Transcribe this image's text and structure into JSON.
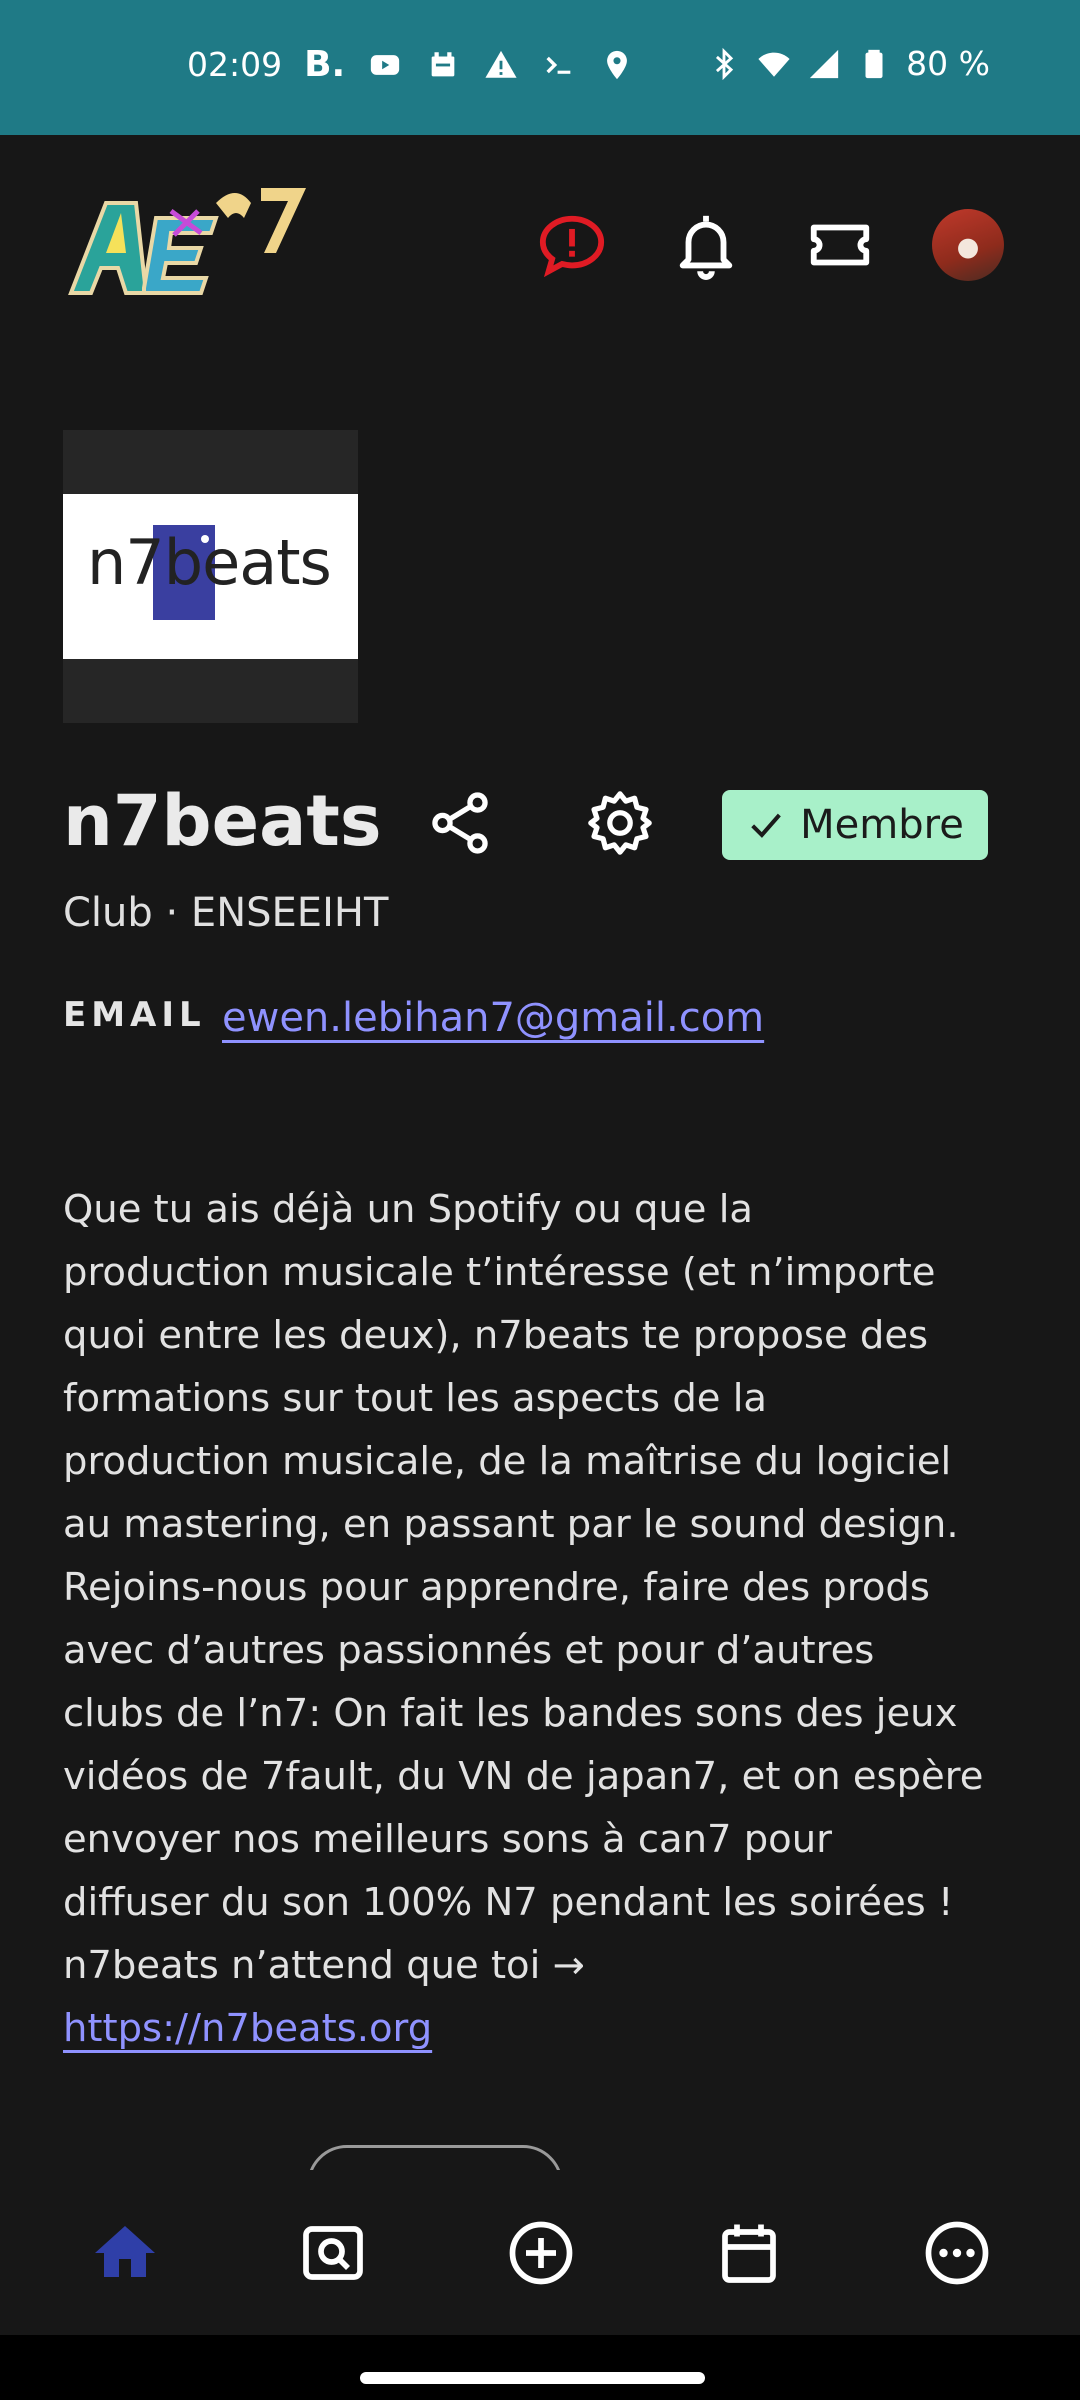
{
  "status_bar": {
    "time": "02:09",
    "b_label": "B.",
    "battery": "80 %",
    "icons": [
      "youtube-icon",
      "calendar-icon",
      "warning-icon",
      "terminal-icon",
      "location-icon",
      "bluetooth-icon",
      "wifi-icon",
      "signal-icon",
      "battery-icon"
    ]
  },
  "app_bar": {
    "logo_name": "AE n7 logo",
    "icons": [
      "report-bug-icon",
      "notifications-icon",
      "ticket-icon",
      "avatar"
    ]
  },
  "club": {
    "logo_text": "n7beats",
    "name": "n7beats",
    "subtitle": "Club · ENSEEIHT",
    "member_label": "Membre",
    "email_label": "EMAIL",
    "email": "ewen.lebihan7@gmail.com",
    "description": [
      "Que tu ais déjà un Spotify ou que la",
      "production musicale t’intéresse (et n’importe",
      "quoi entre les deux), n7beats te propose des",
      "formations sur tout les aspects de la",
      "production musicale, de la maîtrise du logiciel",
      "au mastering, en passant par le sound design.",
      "Rejoins-nous pour apprendre, faire des prods",
      "avec d’autres passionnés et pour d’autres",
      "clubs de l’n7: On fait les bandes sons des jeux",
      "vidéos de 7fault, du VN de japan7, et on espère",
      "envoyer nos meilleurs sons à can7 pour",
      "diffuser du son 100% N7 pendant les soirées !",
      "n7beats n’attend que toi →"
    ],
    "website": "https://n7beats.org"
  },
  "colors": {
    "background": "#171717",
    "status_bar": "#1f7a86",
    "accent_link": "#8f92ff",
    "member_badge": "#a8f0c9",
    "alert_red": "#e01b24",
    "nav_active": "#2f3fa8"
  },
  "bottom_nav": {
    "items": [
      "home-icon",
      "search-page-icon",
      "add-circle-icon",
      "calendar-icon",
      "more-icon"
    ],
    "active": "home-icon"
  }
}
